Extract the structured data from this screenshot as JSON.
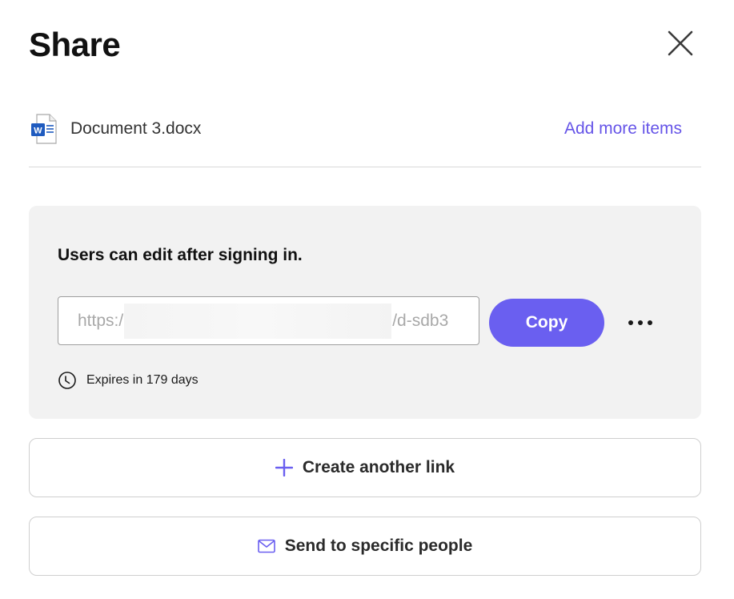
{
  "dialog": {
    "title": "Share",
    "close_icon": "close-icon"
  },
  "item": {
    "icon": "word-document-icon",
    "name": "Document 3.docx",
    "add_more_label": "Add more items"
  },
  "link_panel": {
    "permission_text": "Users can edit after signing in.",
    "link_prefix": "https:/",
    "link_suffix": "/d-sdb3",
    "copy_label": "Copy",
    "more_icon": "more-options-icon",
    "expiry_icon": "clock-icon",
    "expiry_text": "Expires in 179 days"
  },
  "actions": {
    "create_link_label": "Create another link",
    "create_link_icon": "plus-icon",
    "send_label": "Send to specific people",
    "send_icon": "mail-icon"
  },
  "colors": {
    "accent": "#6a5ff0",
    "link_text": "#6655e8",
    "panel_bg": "#f2f2f2",
    "word_blue": "#1f5bbf"
  }
}
